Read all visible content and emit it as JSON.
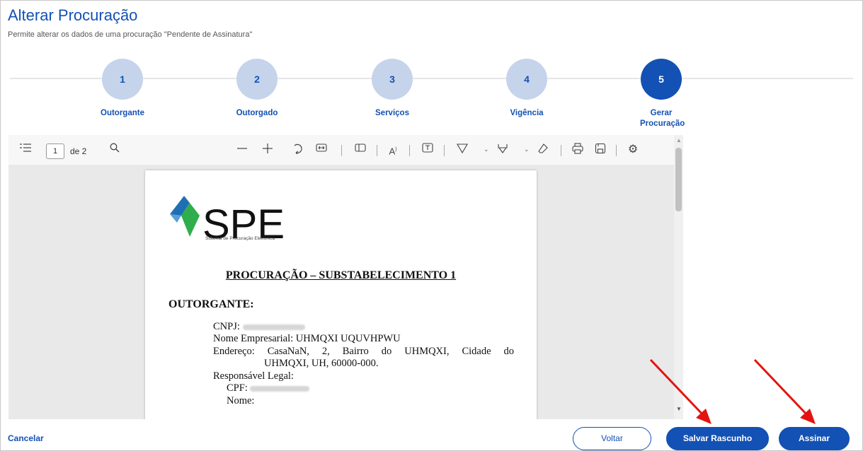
{
  "header": {
    "title": "Alterar Procuração",
    "subtitle": "Permite alterar os dados de uma procuração \"Pendente de Assinatura\""
  },
  "stepper": {
    "steps": [
      {
        "number": "1",
        "label": "Outorgante"
      },
      {
        "number": "2",
        "label": "Outorgado"
      },
      {
        "number": "3",
        "label": "Serviços"
      },
      {
        "number": "4",
        "label": "Vigência"
      },
      {
        "number": "5",
        "label": "Gerar Procuração"
      }
    ],
    "active_step": "5"
  },
  "pdf_viewer": {
    "current_page": "1",
    "page_count_label": "de 2",
    "toolbar_icons": [
      "contents-icon",
      "search-icon",
      "zoom-out-icon",
      "zoom-in-icon",
      "rotate-icon",
      "fit-width-icon",
      "page-view-icon",
      "read-aloud-icon",
      "text-box-icon",
      "draw-icon",
      "highlight-icon",
      "eraser-icon",
      "print-icon",
      "save-icon",
      "settings-icon"
    ]
  },
  "document": {
    "logo_text": "SPE",
    "logo_subtitle": "Sistema de Procuração Eletrônica",
    "title": "PROCURAÇÃO – SUBSTABELECIMENTO 1",
    "section": "OUTORGANTE:",
    "cnpj_label": "CNPJ:",
    "nome_empresarial": "Nome Empresarial: UHMQXI UQUVHPWU",
    "endereco_line1": "Endereço: CasaNaN, 2, Bairro do UHMQXI, Cidade do",
    "endereco_line2": "UHMQXI, UH, 60000-000.",
    "responsavel": "Responsável Legal:",
    "cpf_label": "CPF:",
    "nome_label": "Nome:"
  },
  "footer": {
    "cancel_label": "Cancelar",
    "back_label": "Voltar",
    "save_draft_label": "Salvar Rascunho",
    "sign_label": "Assinar"
  },
  "colors": {
    "primary": "#1351b4",
    "step_inactive": "#c5d4eb",
    "annotation_arrow": "#e3140f",
    "logo_green": "#2fae4b",
    "logo_blue": "#1f6fb5"
  }
}
